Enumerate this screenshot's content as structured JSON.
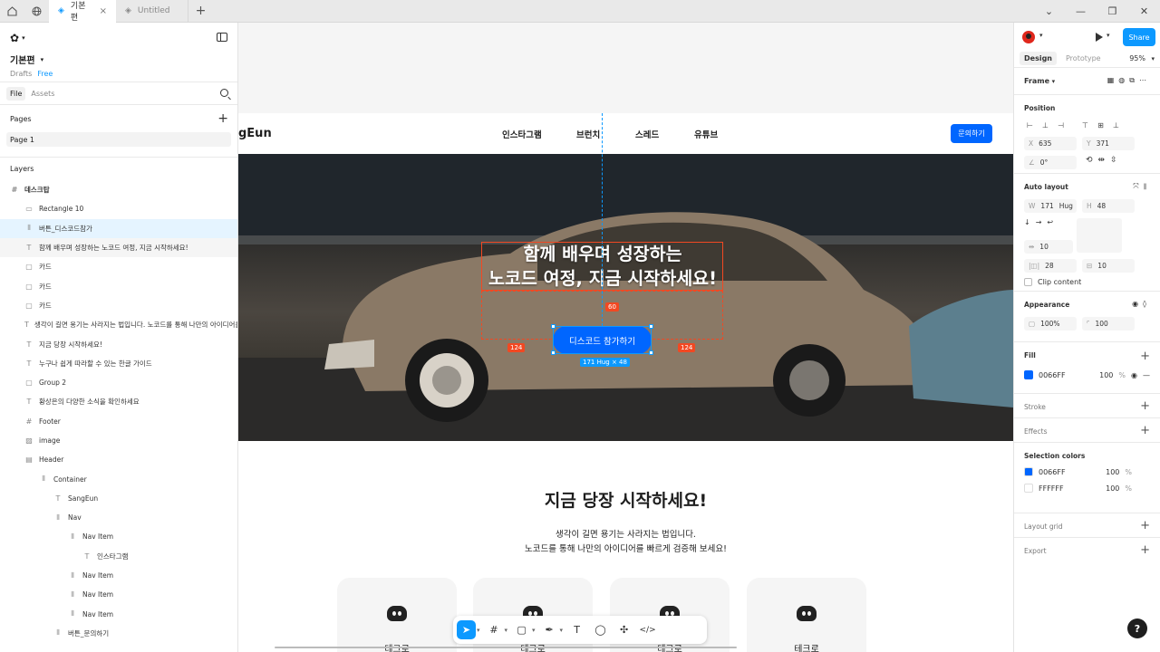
{
  "tabs": {
    "active": "기본편",
    "inactive": "Untitled"
  },
  "left_panel": {
    "title": "기본편",
    "drafts": "Drafts",
    "plan": "Free",
    "file_tab": "File",
    "assets_tab": "Assets",
    "pages_label": "Pages",
    "page1": "Page 1",
    "layers_label": "Layers",
    "layers": [
      {
        "icon": "#",
        "label": "데스크탑",
        "indent": 0,
        "style": "bold"
      },
      {
        "icon": "▭",
        "label": "Rectangle 10",
        "indent": 1,
        "style": ""
      },
      {
        "icon": "⫴",
        "label": "버튼_디스코드참가",
        "indent": 1,
        "style": "sel"
      },
      {
        "icon": "T",
        "label": "함께 배우며 성장하는 노코드 여정, 지금 시작하세요!",
        "indent": 1,
        "style": "hov"
      },
      {
        "icon": "▢",
        "label": "카드",
        "indent": 1,
        "style": ""
      },
      {
        "icon": "▢",
        "label": "카드",
        "indent": 1,
        "style": ""
      },
      {
        "icon": "▢",
        "label": "카드",
        "indent": 1,
        "style": ""
      },
      {
        "icon": "T",
        "label": "생각이 길면 용기는 사라지는 법입니다. 노코드를 통해 나만의 아이디어를",
        "indent": 1,
        "style": ""
      },
      {
        "icon": "T",
        "label": "지금 당장 시작하세요!",
        "indent": 1,
        "style": ""
      },
      {
        "icon": "T",
        "label": "누구나 쉽게 따라할 수 있는 한글 가이드",
        "indent": 1,
        "style": ""
      },
      {
        "icon": "▢",
        "label": "Group 2",
        "indent": 1,
        "style": ""
      },
      {
        "icon": "T",
        "label": "황상은의 다양한 소식을 확인하세요",
        "indent": 1,
        "style": ""
      },
      {
        "icon": "#",
        "label": "Footer",
        "indent": 1,
        "style": ""
      },
      {
        "icon": "▨",
        "label": "image",
        "indent": 1,
        "style": ""
      },
      {
        "icon": "▤",
        "label": "Header",
        "indent": 1,
        "style": ""
      },
      {
        "icon": "⫴",
        "label": "Container",
        "indent": 2,
        "style": ""
      },
      {
        "icon": "T",
        "label": "SangEun",
        "indent": 3,
        "style": ""
      },
      {
        "icon": "⫴",
        "label": "Nav",
        "indent": 3,
        "style": ""
      },
      {
        "icon": "⫴",
        "label": "Nav Item",
        "indent": 4,
        "style": ""
      },
      {
        "icon": "T",
        "label": "인스타그램",
        "indent": 5,
        "style": ""
      },
      {
        "icon": "⫴",
        "label": "Nav Item",
        "indent": 4,
        "style": ""
      },
      {
        "icon": "⫴",
        "label": "Nav Item",
        "indent": 4,
        "style": ""
      },
      {
        "icon": "⫴",
        "label": "Nav Item",
        "indent": 4,
        "style": ""
      },
      {
        "icon": "⫴",
        "label": "버튼_문의하기",
        "indent": 3,
        "style": ""
      }
    ]
  },
  "canvas": {
    "logo": "gEun",
    "nav": [
      "인스타그램",
      "브런치",
      "스레드",
      "유튜브"
    ],
    "contact_button": "문의하기",
    "hero_title_line1": "함께 배우며 성장하는",
    "hero_title_line2": "노코드 여정, 지금 시작하세요!",
    "discord_button": "디스코드 참가하기",
    "spacing_top": "60",
    "spacing_left": "124",
    "spacing_right": "124",
    "dimension_label": "171 Hug × 48",
    "section_title": "지금 당장 시작하세요!",
    "section_desc_line1": "생각이 길면 용기는 사라지는 법입니다.",
    "section_desc_line2": "노코드를 통해 나만의 아이디어를 빠르게 검증해 보세요!",
    "cards": [
      "테크로",
      "테크로",
      "테크로",
      "테크로"
    ]
  },
  "right_panel": {
    "share": "Share",
    "design_tab": "Design",
    "prototype_tab": "Prototype",
    "zoom": "95%",
    "frame_label": "Frame",
    "position_label": "Position",
    "x_key": "X",
    "x_val": "635",
    "y_key": "Y",
    "y_val": "371",
    "rotation": "0°",
    "auto_layout_label": "Auto layout",
    "w_key": "W",
    "w_val": "171",
    "w_mode": "Hug",
    "h_key": "H",
    "h_val": "48",
    "gap": "10",
    "pad_h": "28",
    "pad_v": "10",
    "clip_content": "Clip content",
    "appearance_label": "Appearance",
    "opacity": "100%",
    "radius": "100",
    "fill_label": "Fill",
    "fill_hex": "0066FF",
    "fill_pct": "100",
    "pct_sign": "%",
    "stroke_label": "Stroke",
    "effects_label": "Effects",
    "selection_colors_label": "Selection colors",
    "sel_colors": [
      {
        "hex": "0066FF",
        "pct": "100",
        "color": "#0066ff"
      },
      {
        "hex": "FFFFFF",
        "pct": "100",
        "color": "#ffffff"
      }
    ],
    "layout_grid_label": "Layout grid",
    "export_label": "Export",
    "help": "?"
  }
}
